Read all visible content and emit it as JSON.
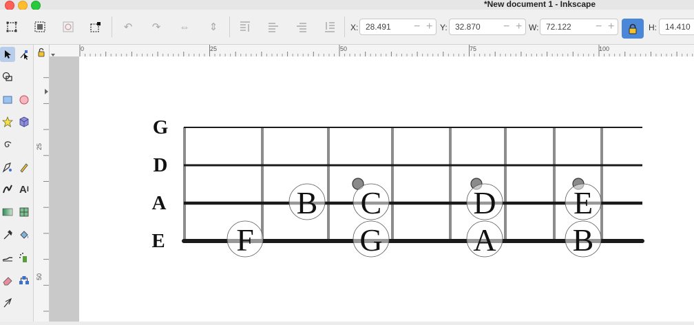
{
  "window": {
    "title": "*New document 1 - Inkscape"
  },
  "toolbar": {
    "x_label": "X:",
    "x_value": "28.491",
    "y_label": "Y:",
    "y_value": "32.870",
    "w_label": "W:",
    "w_value": "72.122",
    "h_label": "H:",
    "h_value": "14.410"
  },
  "rulers": {
    "horizontal": [
      "0",
      "25",
      "50",
      "75",
      "100"
    ],
    "vertical": [
      "25",
      "50"
    ]
  },
  "fretboard": {
    "strings": [
      "G",
      "D",
      "A",
      "E"
    ],
    "notes": [
      {
        "label": "F",
        "string": "E"
      },
      {
        "label": "B",
        "string": "A"
      },
      {
        "label": "C",
        "string": "A"
      },
      {
        "label": "G",
        "string": "E"
      },
      {
        "label": "D",
        "string": "A"
      },
      {
        "label": "A",
        "string": "E"
      },
      {
        "label": "E",
        "string": "A"
      },
      {
        "label": "B",
        "string": "E"
      }
    ]
  },
  "colors": {
    "accent": "#4a87d8",
    "string": "#1a1a1a",
    "fret": "#8c8c8c"
  }
}
